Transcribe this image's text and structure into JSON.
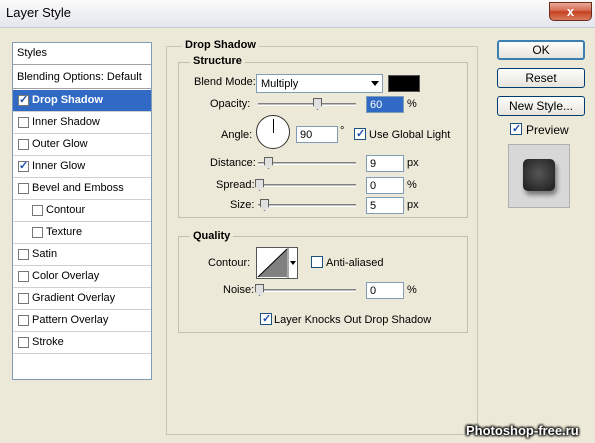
{
  "window": {
    "title": "Layer Style",
    "close_glyph": "x"
  },
  "styles_panel": {
    "header": "Styles",
    "blending_options": "Blending Options: Default",
    "items": [
      {
        "label": "Drop Shadow",
        "checked": true,
        "selected": true,
        "indent": false
      },
      {
        "label": "Inner Shadow",
        "checked": false,
        "selected": false,
        "indent": false
      },
      {
        "label": "Outer Glow",
        "checked": false,
        "selected": false,
        "indent": false
      },
      {
        "label": "Inner Glow",
        "checked": true,
        "selected": false,
        "indent": false
      },
      {
        "label": "Bevel and Emboss",
        "checked": false,
        "selected": false,
        "indent": false
      },
      {
        "label": "Contour",
        "checked": false,
        "selected": false,
        "indent": true
      },
      {
        "label": "Texture",
        "checked": false,
        "selected": false,
        "indent": true
      },
      {
        "label": "Satin",
        "checked": false,
        "selected": false,
        "indent": false
      },
      {
        "label": "Color Overlay",
        "checked": false,
        "selected": false,
        "indent": false
      },
      {
        "label": "Gradient Overlay",
        "checked": false,
        "selected": false,
        "indent": false
      },
      {
        "label": "Pattern Overlay",
        "checked": false,
        "selected": false,
        "indent": false
      },
      {
        "label": "Stroke",
        "checked": false,
        "selected": false,
        "indent": false
      }
    ]
  },
  "drop_shadow": {
    "title": "Drop Shadow",
    "structure": {
      "title": "Structure",
      "blend_mode_label": "Blend Mode:",
      "blend_mode_value": "Multiply",
      "shadow_color": "#000000",
      "opacity_label": "Opacity:",
      "opacity_value": "60",
      "opacity_unit": "%",
      "angle_label": "Angle:",
      "angle_value": "90",
      "angle_unit": "°",
      "use_global_light_label": "Use Global Light",
      "use_global_light_checked": true,
      "distance_label": "Distance:",
      "distance_value": "9",
      "distance_unit": "px",
      "spread_label": "Spread:",
      "spread_value": "0",
      "spread_unit": "%",
      "size_label": "Size:",
      "size_value": "5",
      "size_unit": "px"
    },
    "quality": {
      "title": "Quality",
      "contour_label": "Contour:",
      "anti_aliased_label": "Anti-aliased",
      "anti_aliased_checked": false,
      "noise_label": "Noise:",
      "noise_value": "0",
      "noise_unit": "%"
    },
    "knockout_label": "Layer Knocks Out Drop Shadow",
    "knockout_checked": true
  },
  "buttons": {
    "ok": "OK",
    "reset": "Reset",
    "new_style": "New Style...",
    "preview_label": "Preview",
    "preview_checked": true
  },
  "watermark": "Photoshop-free.ru",
  "colors": {
    "selection": "#316ac5",
    "dialog_bg": "#ece9d8",
    "close_button": "#c4401f"
  }
}
